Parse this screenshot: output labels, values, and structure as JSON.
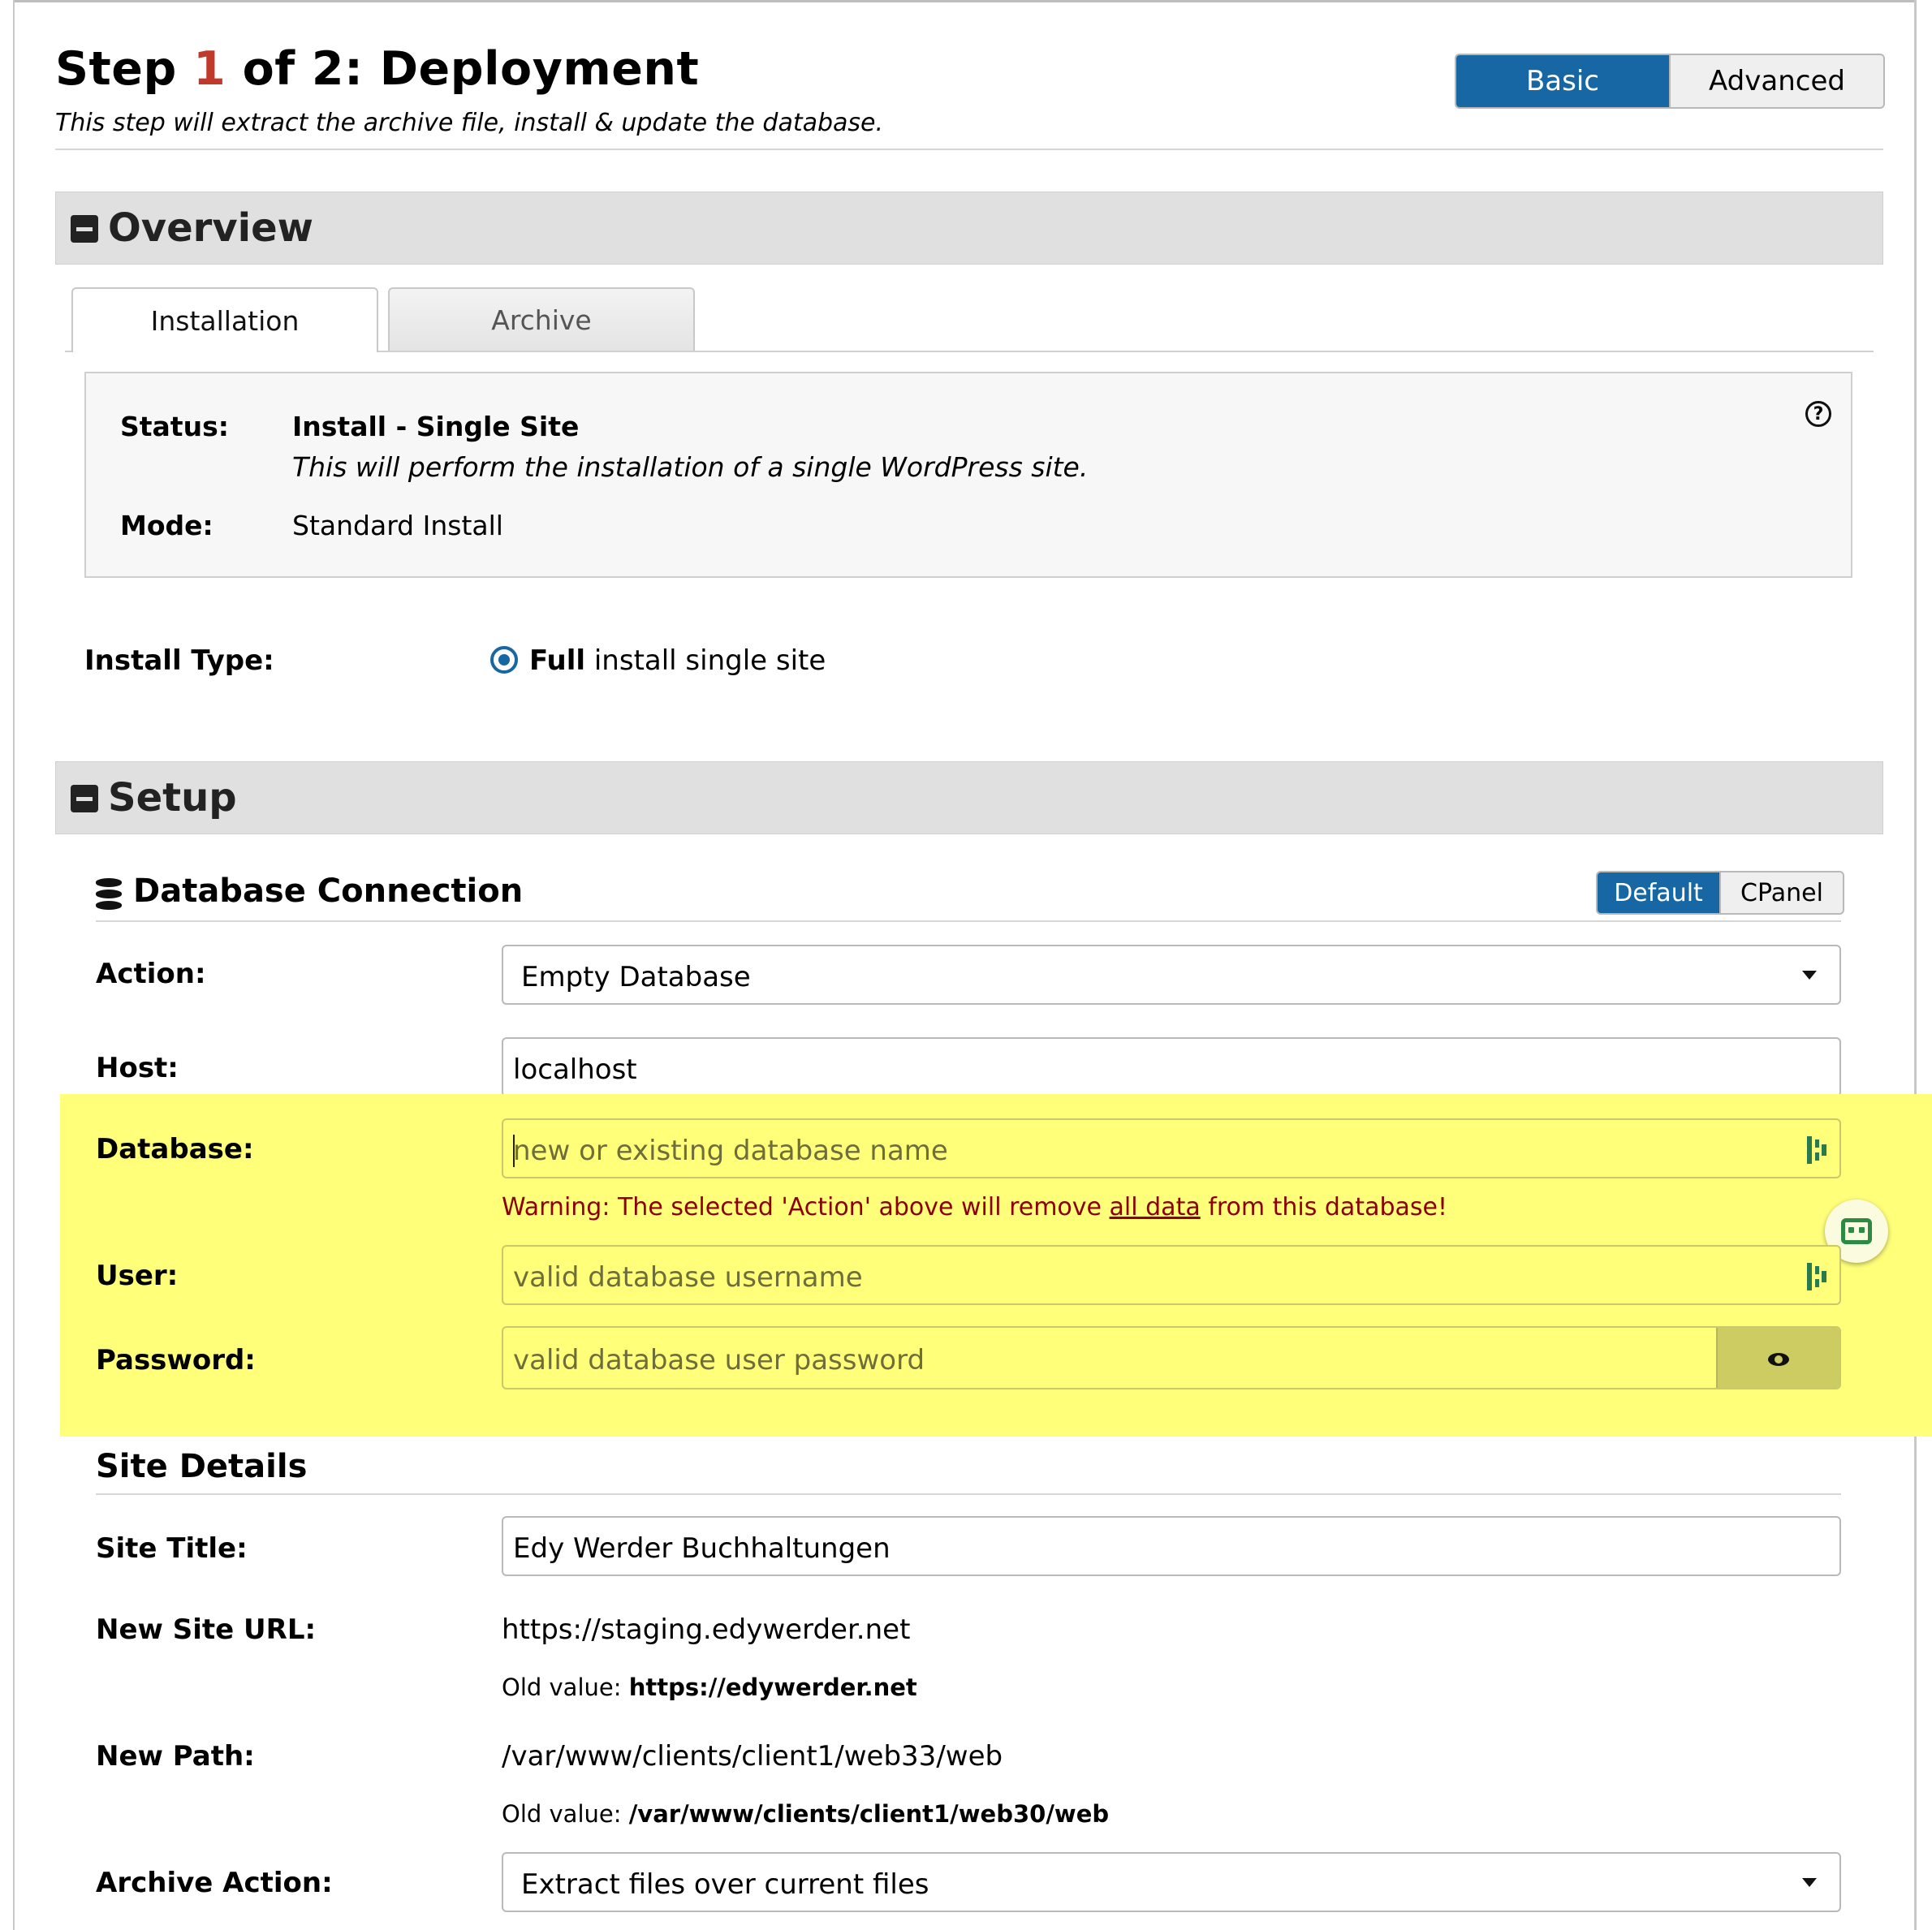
{
  "header": {
    "title_prefix": "Step ",
    "title_num": "1",
    "title_suffix": " of 2: Deployment",
    "subtitle": "This step will extract the archive file, install & update the database.",
    "mode_basic": "Basic",
    "mode_advanced": "Advanced"
  },
  "overview": {
    "title": "Overview",
    "tabs": [
      "Installation",
      "Archive"
    ],
    "status_label": "Status:",
    "status_value": "Install - Single Site",
    "status_desc": "This will perform the installation of a single WordPress site.",
    "mode_label": "Mode:",
    "mode_value": "Standard Install",
    "help_glyph": "?",
    "install_type_label": "Install Type:",
    "install_type_bold": "Full",
    "install_type_rest": " install single site"
  },
  "setup": {
    "title": "Setup",
    "db_heading": "Database Connection",
    "conn_default": "Default",
    "conn_cpanel": "CPanel",
    "action_label": "Action:",
    "action_value": "Empty Database",
    "host_label": "Host:",
    "host_value": "localhost",
    "database_label": "Database:",
    "database_placeholder": "new or existing database name",
    "warning_pre": "Warning: The selected 'Action' above will remove ",
    "warning_link": "all data",
    "warning_post": " from this database!",
    "user_label": "User:",
    "user_placeholder": "valid database username",
    "password_label": "Password:",
    "password_placeholder": "valid database user password"
  },
  "site_details": {
    "heading": "Site Details",
    "site_title_label": "Site Title:",
    "site_title_value": "Edy Werder Buchhaltungen",
    "url_label": "New Site URL:",
    "url_value": "https://staging.edywerder.net",
    "url_old_label": "Old value: ",
    "url_old_value": "https://edywerder.net",
    "path_label": "New Path:",
    "path_value": "/var/www/clients/client1/web33/web",
    "path_old_label": "Old value: ",
    "path_old_value": "/var/www/clients/client1/web30/web",
    "archive_label": "Archive Action:",
    "archive_value": "Extract files over current files"
  },
  "colors": {
    "accent": "#1767a5",
    "step_number": "#c0392b",
    "highlight": "#ffff7a",
    "warning": "#8b0000",
    "password_manager_icon": "#2b7a4b"
  },
  "icons": [
    "minus-square-icon",
    "help-circle-icon",
    "database-icon",
    "password-manager-icon",
    "eye-icon",
    "robot-assistant-icon",
    "chevron-down-icon"
  ]
}
